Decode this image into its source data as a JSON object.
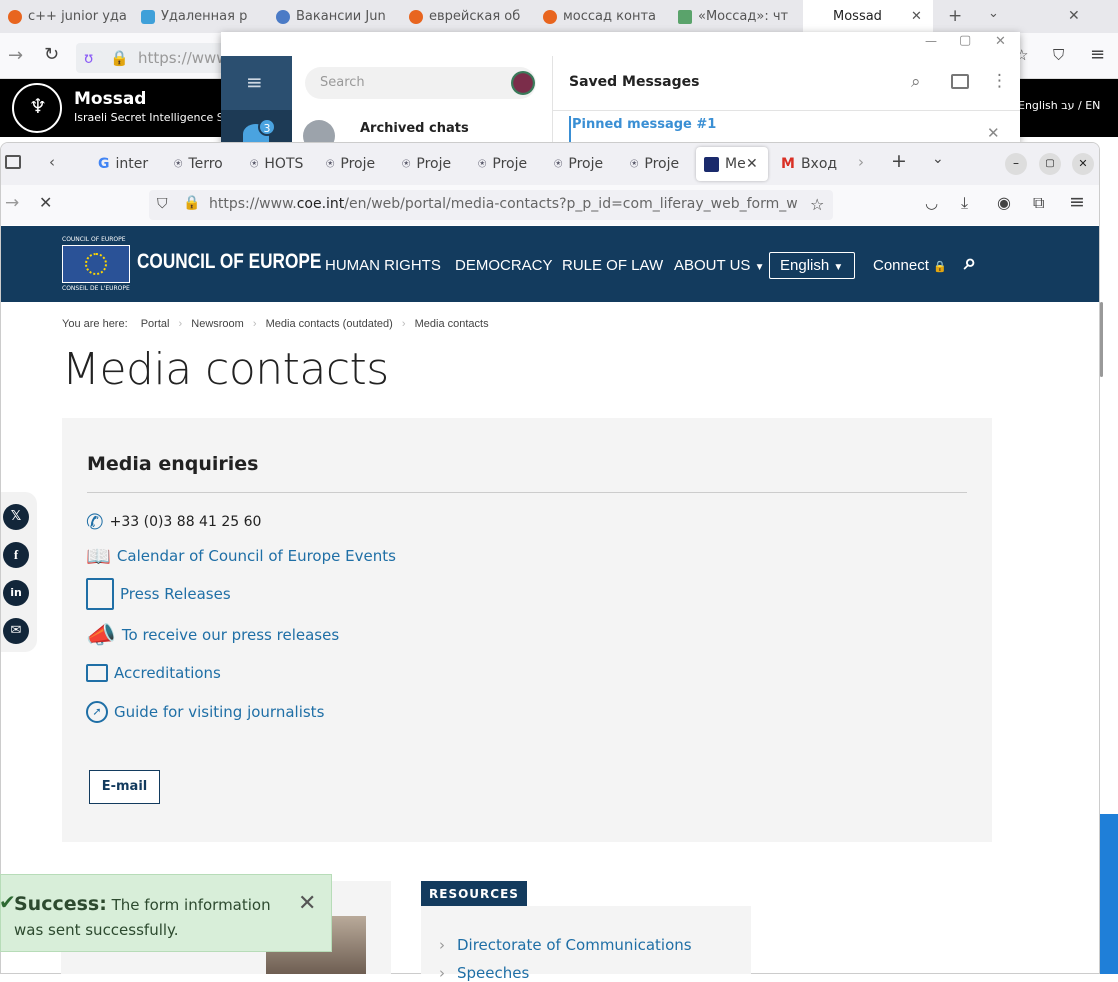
{
  "back_browser": {
    "tabs": [
      {
        "label": "c++ junior уда",
        "color": "#e8651f"
      },
      {
        "label": "Удаленная р",
        "color": "#3fa0d9"
      },
      {
        "label": "Вакансии Jun",
        "color": "#4b7bc6"
      },
      {
        "label": "еврейская об",
        "color": "#e8651f"
      },
      {
        "label": "моссад конта",
        "color": "#e8651f"
      },
      {
        "label": "«Моссад»: чт",
        "color": "#5aa36b"
      },
      {
        "label": "Mossad",
        "color": "#ffffff"
      }
    ],
    "url": "https://www.",
    "site_title": "Mossad",
    "site_subtitle": "Israeli Secret Intelligence Se",
    "lang": "English",
    "lang_he": "עב",
    "lang_sep": "/",
    "lang_en": "EN"
  },
  "telegram": {
    "search_placeholder": "Search",
    "header_title": "Saved Messages",
    "archived_label": "Archived chats",
    "badge_count": "3",
    "pinned_label": "Pinned message #1"
  },
  "front_browser": {
    "tabs": [
      {
        "label": "inter"
      },
      {
        "label": "Terro"
      },
      {
        "label": "HOTS"
      },
      {
        "label": "Proje"
      },
      {
        "label": "Proje"
      },
      {
        "label": "Proje"
      },
      {
        "label": "Proje"
      },
      {
        "label": "Proje"
      },
      {
        "label": "Me"
      },
      {
        "label": "Вход"
      }
    ],
    "url_prefix": "https://www.",
    "url_host": "coe.int",
    "url_rest": "/en/web/portal/media-contacts?p_p_id=com_liferay_web_form_w"
  },
  "coe": {
    "logo_top": "COUNCIL OF EUROPE",
    "logo_bottom": "CONSEIL DE L'EUROPE",
    "brand": "COUNCIL OF EUROPE",
    "nav": [
      "HUMAN RIGHTS",
      "DEMOCRACY",
      "RULE OF LAW",
      "ABOUT US"
    ],
    "language": "English",
    "connect": "Connect"
  },
  "page": {
    "breadcrumb_intro": "You are here:",
    "breadcrumb": [
      "Portal",
      "Newsroom",
      "Media contacts (outdated)",
      "Media contacts"
    ],
    "title": "Media contacts",
    "box_title": "Media enquiries",
    "phone": "+33 (0)3 88 41 25 60",
    "links": [
      "Calendar of Council of Europe Events",
      "Press Releases",
      "To receive our press releases",
      "Accreditations",
      "Guide for visiting journalists"
    ],
    "email_button": "E-mail",
    "resources_label": "RESOURCES",
    "resources_links": [
      "Directorate of Communications",
      "Speeches"
    ]
  },
  "success": {
    "title": "Success:",
    "message": "The form information was sent successfully."
  },
  "share_icons": [
    "x-icon",
    "facebook-icon",
    "linkedin-icon",
    "email-icon"
  ]
}
